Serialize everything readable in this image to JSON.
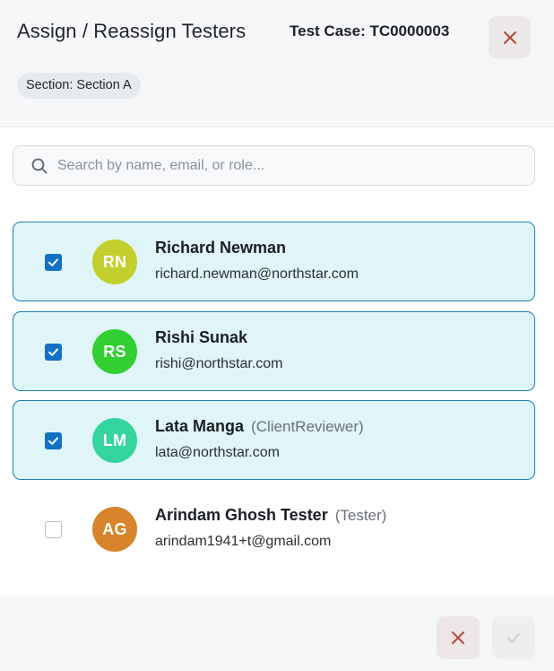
{
  "header": {
    "title": "Assign / Reassign Testers",
    "test_case": "Test Case: TC0000003",
    "section_badge": "Section: Section A",
    "close_icon": "close-icon"
  },
  "search": {
    "placeholder": "Search by name, email, or role...",
    "value": "",
    "icon": "search-icon"
  },
  "testers": [
    {
      "initials": "RN",
      "name": "Richard Newman",
      "role": "",
      "email": "richard.newman@northstar.com",
      "selected": true,
      "avatar_color": "#c3cf2c"
    },
    {
      "initials": "RS",
      "name": "Rishi Sunak",
      "role": "",
      "email": "rishi@northstar.com",
      "selected": true,
      "avatar_color": "#31cf31"
    },
    {
      "initials": "LM",
      "name": "Lata Manga",
      "role": "(ClientReviewer)",
      "email": "lata@northstar.com",
      "selected": true,
      "avatar_color": "#34d49f"
    },
    {
      "initials": "AG",
      "name": "Arindam Ghosh Tester",
      "role": "(Tester)",
      "email": "arindam1941+t@gmail.com",
      "selected": false,
      "avatar_color": "#d8842a"
    }
  ],
  "footer": {
    "cancel_icon": "close-icon",
    "confirm_icon": "check-icon"
  },
  "colors": {
    "accent": "#1271c4",
    "selected_row_bg": "#dff5f8",
    "selected_row_border": "#1e7fb4",
    "danger": "#b5473f"
  }
}
